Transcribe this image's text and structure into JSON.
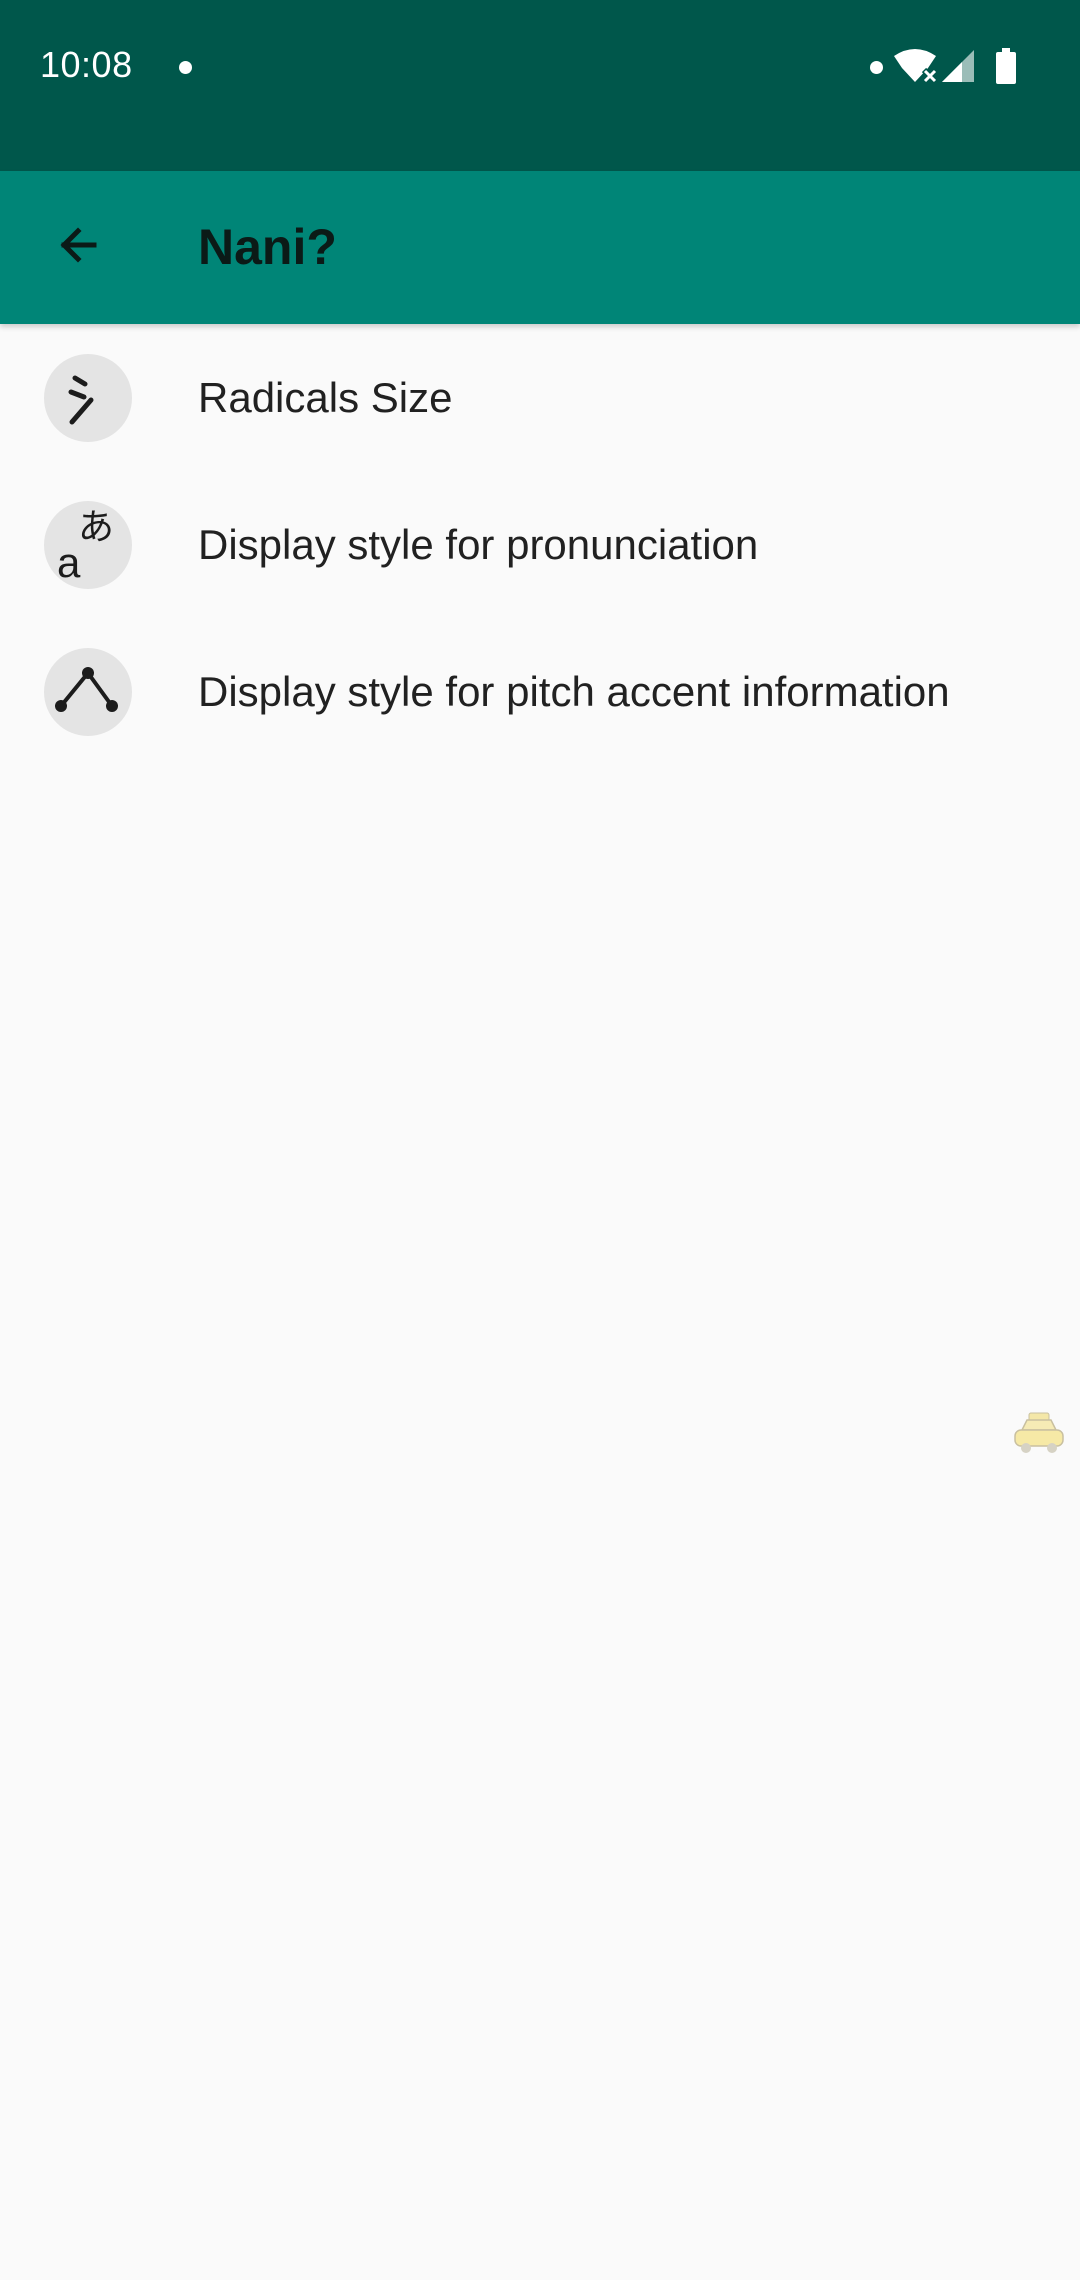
{
  "status_bar": {
    "time": "10:08",
    "background_color": "#00574b",
    "icons": [
      "notification-dot-icon",
      "wifi-off-icon",
      "signal-icon",
      "battery-icon"
    ]
  },
  "app_bar": {
    "title": "Nani?",
    "back_icon": "arrow-back-icon",
    "background_color": "#008577"
  },
  "settings": {
    "items": [
      {
        "label": "Radicals Size",
        "icon": "radical-icon"
      },
      {
        "label": "Display style for pronunciation",
        "icon": "kana-romaji-icon"
      },
      {
        "label": "Display style for pitch accent information",
        "icon": "pitch-accent-icon"
      }
    ]
  },
  "overlay": {
    "icon": "taxi-icon"
  }
}
